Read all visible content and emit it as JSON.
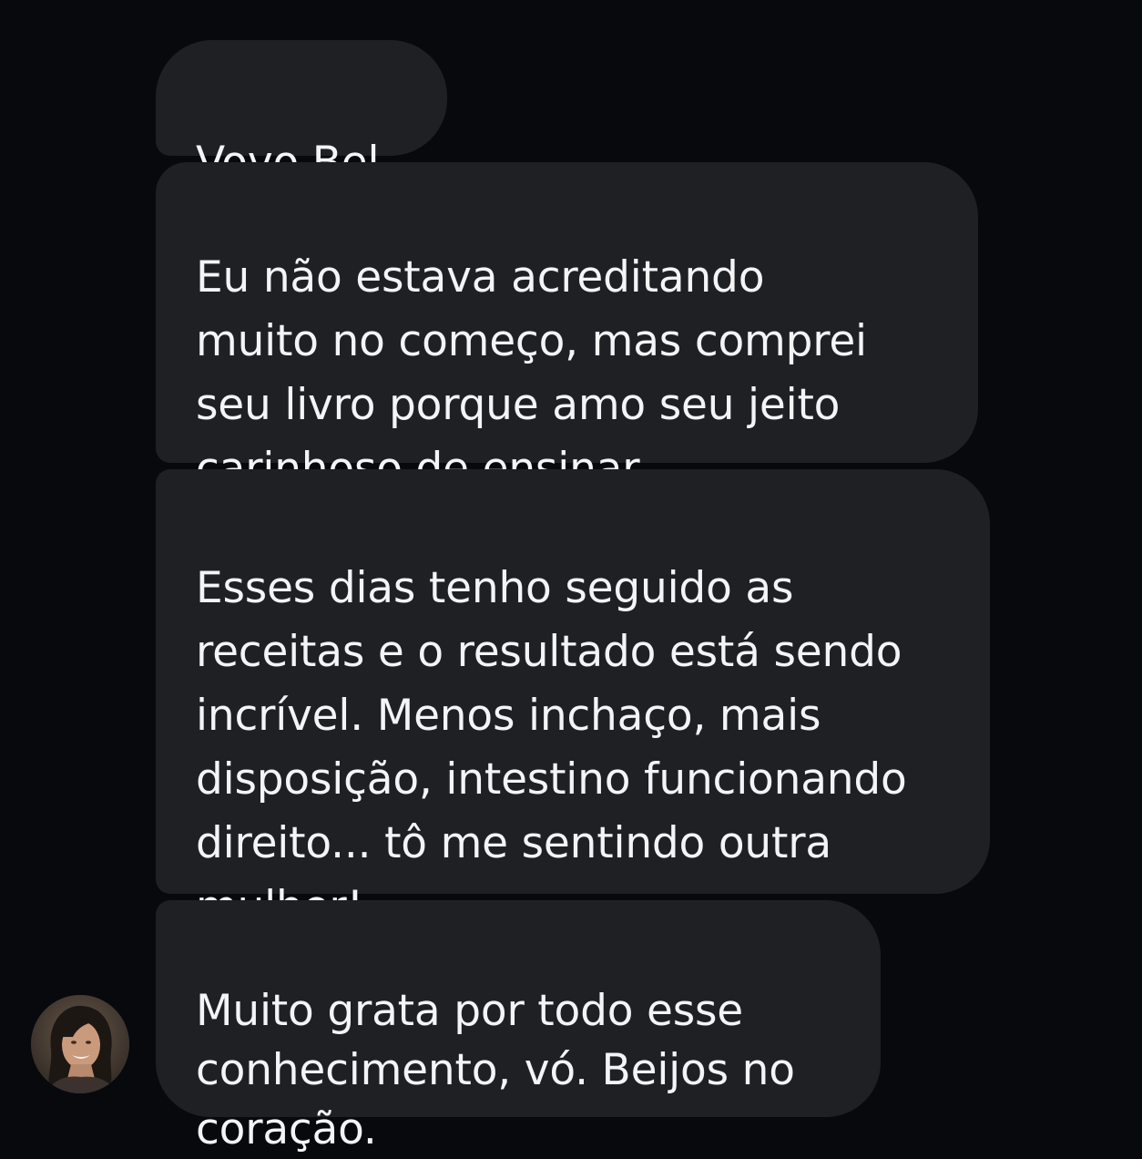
{
  "conversation": {
    "messages": [
      {
        "text": "Vovo Bel."
      },
      {
        "text": "Eu não estava acreditando\nmuito no começo, mas comprei\nseu livro porque amo seu jeito\ncarinhoso de ensinar."
      },
      {
        "text": "Esses dias tenho seguido as\nreceitas e o resultado está sendo\nincrível. Menos inchaço, mais\ndisposição, intestino funcionando\ndireito... tô me sentindo outra\nmulher!"
      },
      {
        "text": "Muito grata por todo esse\nconhecimento, vó. Beijos no\ncoração."
      }
    ]
  },
  "colors": {
    "background": "#08090c",
    "bubble": "#1f2024",
    "text": "#f4f4f6"
  },
  "icons": {
    "avatar": "sender-avatar-photo"
  }
}
